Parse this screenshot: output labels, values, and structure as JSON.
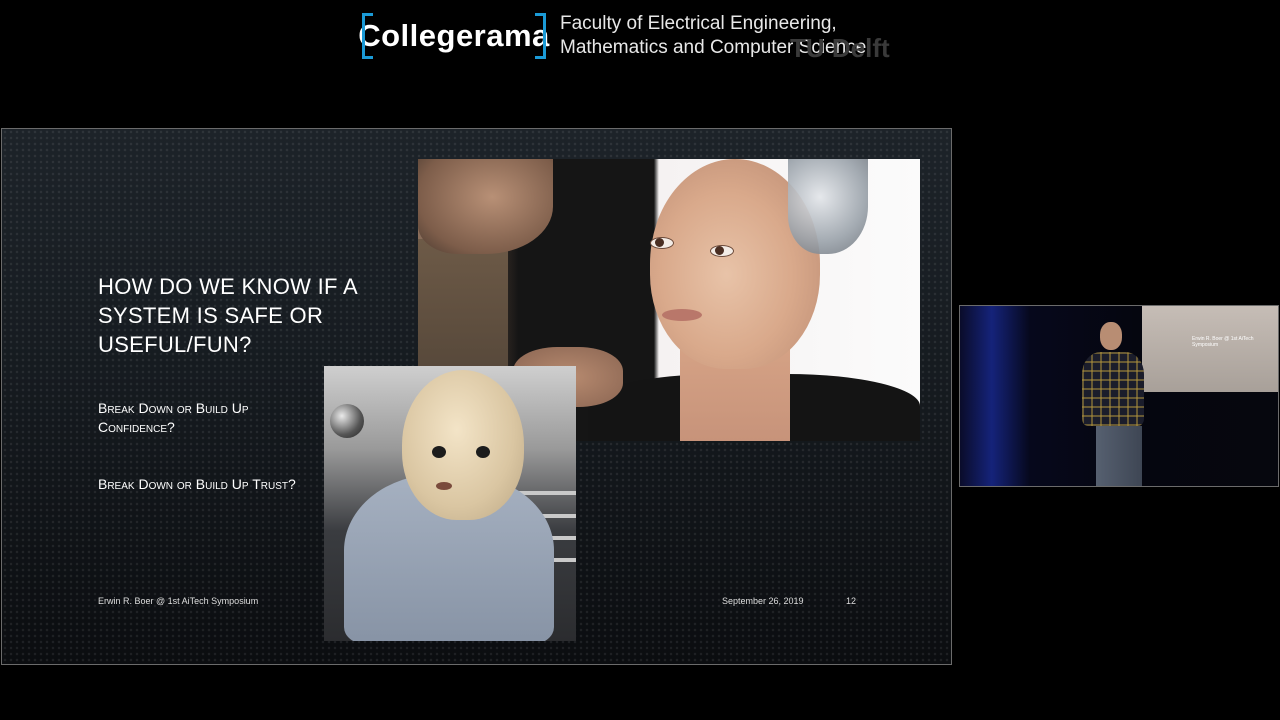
{
  "header": {
    "logo_text": "Collegerama",
    "faculty_line1": "Faculty of Electrical Engineering,",
    "faculty_line2": "Mathematics and Computer Science",
    "university_mark": "TU Delft"
  },
  "slide": {
    "title": "HOW DO WE KNOW IF A SYSTEM IS SAFE OR USEFUL/FUN?",
    "bullet_1": "Break Down or Build Up Confidence?",
    "bullet_2": "Break Down or Build Up Trust?",
    "footer_author": "Erwin R. Boer @ 1st AiTech Symposium",
    "footer_date": "September 26, 2019",
    "footer_page": "12",
    "images": [
      "humanoid-robot-sophia-photo",
      "robot-baby-photo"
    ]
  },
  "speaker_video": {
    "screen_text": "Erwin R. Boer @ 1st AiTech Symposium"
  },
  "colors": {
    "background": "#000000",
    "logo_bracket": "#1b9ad6",
    "text": "#ffffff"
  }
}
